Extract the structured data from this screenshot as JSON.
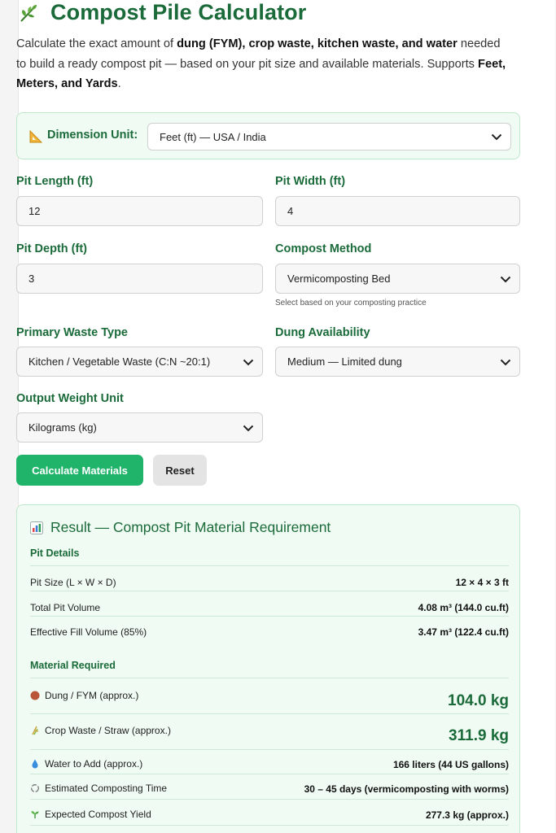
{
  "header": {
    "title": "Compost Pile Calculator",
    "intro_part1": "Calculate the exact amount of ",
    "intro_b1": "dung (FYM), crop waste, kitchen waste, and water",
    "intro_part2": " needed to build a ready compost pit — based on your pit size and available materials. Supports ",
    "intro_b2": "Feet, Meters, and Yards",
    "intro_part3": "."
  },
  "unit": {
    "label": "Dimension Unit:",
    "value": "Feet (ft) — USA / India"
  },
  "form": {
    "length_label": "Pit Length (ft)",
    "length_value": "12",
    "width_label": "Pit Width (ft)",
    "width_value": "4",
    "depth_label": "Pit Depth (ft)",
    "depth_value": "3",
    "method_label": "Compost Method",
    "method_value": "Vermicomposting Bed",
    "method_hint": "Select based on your composting practice",
    "waste_label": "Primary Waste Type",
    "waste_value": "Kitchen / Vegetable Waste (C:N ~20:1)",
    "dung_label": "Dung Availability",
    "dung_value": "Medium — Limited dung",
    "weight_label": "Output Weight Unit",
    "weight_value": "Kilograms (kg)"
  },
  "buttons": {
    "calculate": "Calculate Materials",
    "reset": "Reset"
  },
  "result": {
    "title": "Result — Compost Pit Material Requirement",
    "pit_section": "Pit Details",
    "pit_rows": [
      {
        "label": "Pit Size (L × W × D)",
        "value": "12 × 4 × 3 ft"
      },
      {
        "label": "Total Pit Volume",
        "value": "4.08 m³ (144.0 cu.ft)"
      },
      {
        "label": "Effective Fill Volume (85%)",
        "value": "3.47 m³ (122.4 cu.ft)"
      }
    ],
    "material_section": "Material Required",
    "material_rows": [
      {
        "label": "Dung / FYM (approx.)",
        "value": "104.0 kg",
        "icon": "brown-circle-icon"
      },
      {
        "label": "Crop Waste / Straw (approx.)",
        "value": "311.9 kg",
        "icon": "straw-icon"
      },
      {
        "label": "Water to Add (approx.)",
        "value": "166 liters (44 US gallons)",
        "icon": "water-drop-icon"
      },
      {
        "label": "Estimated Composting Time",
        "value": "30 – 45 days (vermicomposting with worms)",
        "icon": "recycle-icon"
      },
      {
        "label": "Expected Compost Yield",
        "value": "277.3 kg (approx.)",
        "icon": "sprout-icon"
      }
    ]
  },
  "colors": {
    "accent": "#1b6b3a",
    "button": "#20b36a",
    "panel_bg": "#f0fbf3",
    "panel_border": "#bfe8cb"
  }
}
